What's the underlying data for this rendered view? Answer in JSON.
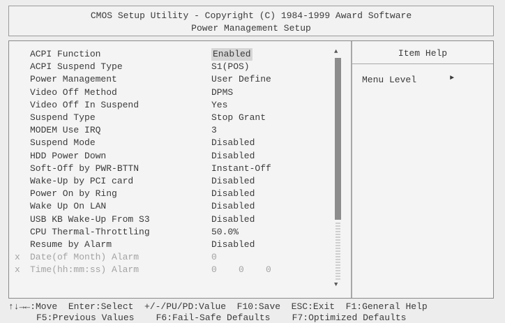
{
  "header": {
    "line1": "CMOS Setup Utility - Copyright (C) 1984-1999 Award Software",
    "line2": "Power Management Setup"
  },
  "settings": [
    {
      "label": "ACPI Function",
      "value": "Enabled",
      "disabled": false
    },
    {
      "label": "ACPI Suspend Type",
      "value": "S1(POS)",
      "disabled": false
    },
    {
      "label": "Power Management",
      "value": "User Define",
      "disabled": false
    },
    {
      "label": "Video Off Method",
      "value": "DPMS",
      "disabled": false
    },
    {
      "label": "Video Off In Suspend",
      "value": "Yes",
      "disabled": false
    },
    {
      "label": "Suspend Type",
      "value": "Stop Grant",
      "disabled": false
    },
    {
      "label": "MODEM Use IRQ",
      "value": "3",
      "disabled": false
    },
    {
      "label": "Suspend Mode",
      "value": "Disabled",
      "disabled": false
    },
    {
      "label": "HDD Power Down",
      "value": "Disabled",
      "disabled": false
    },
    {
      "label": "Soft-Off by PWR-BTTN",
      "value": "Instant-Off",
      "disabled": false
    },
    {
      "label": "Wake-Up by PCI card",
      "value": "Disabled",
      "disabled": false
    },
    {
      "label": "Power On by Ring",
      "value": "Disabled",
      "disabled": false
    },
    {
      "label": "Wake Up On LAN",
      "value": "Disabled",
      "disabled": false
    },
    {
      "label": "USB KB Wake-Up From S3",
      "value": "Disabled",
      "disabled": false
    },
    {
      "label": "CPU Thermal-Throttling",
      "value": "50.0%",
      "disabled": false
    },
    {
      "label": "Resume by Alarm",
      "value": "Disabled",
      "disabled": false
    },
    {
      "label": "Date(of Month) Alarm",
      "value": "0",
      "disabled": true,
      "marker": "x"
    },
    {
      "label": "Time(hh:mm:ss) Alarm",
      "value": "0    0    0",
      "disabled": true,
      "marker": "x"
    }
  ],
  "item_help": {
    "title": "Item Help",
    "menu_level_label": "Menu Level"
  },
  "footer": {
    "line1": "↑↓→←:Move  Enter:Select  +/-/PU/PD:Value  F10:Save  ESC:Exit  F1:General Help",
    "line2": "F5:Previous Values    F6:Fail-Safe Defaults    F7:Optimized Defaults"
  }
}
